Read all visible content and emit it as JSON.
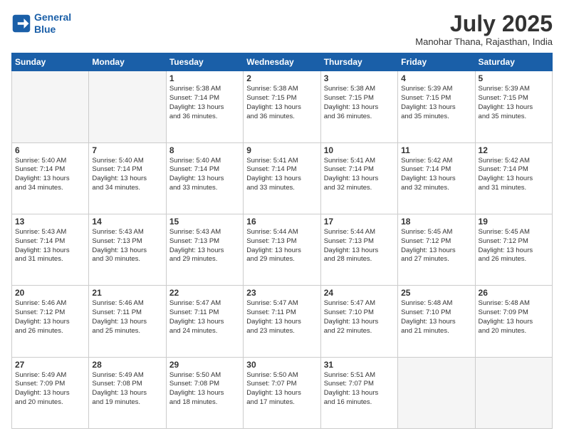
{
  "logo": {
    "line1": "General",
    "line2": "Blue"
  },
  "title": "July 2025",
  "subtitle": "Manohar Thana, Rajasthan, India",
  "weekdays": [
    "Sunday",
    "Monday",
    "Tuesday",
    "Wednesday",
    "Thursday",
    "Friday",
    "Saturday"
  ],
  "days": [
    {
      "num": "",
      "info": ""
    },
    {
      "num": "",
      "info": ""
    },
    {
      "num": "1",
      "info": "Sunrise: 5:38 AM\nSunset: 7:14 PM\nDaylight: 13 hours\nand 36 minutes."
    },
    {
      "num": "2",
      "info": "Sunrise: 5:38 AM\nSunset: 7:15 PM\nDaylight: 13 hours\nand 36 minutes."
    },
    {
      "num": "3",
      "info": "Sunrise: 5:38 AM\nSunset: 7:15 PM\nDaylight: 13 hours\nand 36 minutes."
    },
    {
      "num": "4",
      "info": "Sunrise: 5:39 AM\nSunset: 7:15 PM\nDaylight: 13 hours\nand 35 minutes."
    },
    {
      "num": "5",
      "info": "Sunrise: 5:39 AM\nSunset: 7:15 PM\nDaylight: 13 hours\nand 35 minutes."
    },
    {
      "num": "6",
      "info": "Sunrise: 5:40 AM\nSunset: 7:14 PM\nDaylight: 13 hours\nand 34 minutes."
    },
    {
      "num": "7",
      "info": "Sunrise: 5:40 AM\nSunset: 7:14 PM\nDaylight: 13 hours\nand 34 minutes."
    },
    {
      "num": "8",
      "info": "Sunrise: 5:40 AM\nSunset: 7:14 PM\nDaylight: 13 hours\nand 33 minutes."
    },
    {
      "num": "9",
      "info": "Sunrise: 5:41 AM\nSunset: 7:14 PM\nDaylight: 13 hours\nand 33 minutes."
    },
    {
      "num": "10",
      "info": "Sunrise: 5:41 AM\nSunset: 7:14 PM\nDaylight: 13 hours\nand 32 minutes."
    },
    {
      "num": "11",
      "info": "Sunrise: 5:42 AM\nSunset: 7:14 PM\nDaylight: 13 hours\nand 32 minutes."
    },
    {
      "num": "12",
      "info": "Sunrise: 5:42 AM\nSunset: 7:14 PM\nDaylight: 13 hours\nand 31 minutes."
    },
    {
      "num": "13",
      "info": "Sunrise: 5:43 AM\nSunset: 7:14 PM\nDaylight: 13 hours\nand 31 minutes."
    },
    {
      "num": "14",
      "info": "Sunrise: 5:43 AM\nSunset: 7:13 PM\nDaylight: 13 hours\nand 30 minutes."
    },
    {
      "num": "15",
      "info": "Sunrise: 5:43 AM\nSunset: 7:13 PM\nDaylight: 13 hours\nand 29 minutes."
    },
    {
      "num": "16",
      "info": "Sunrise: 5:44 AM\nSunset: 7:13 PM\nDaylight: 13 hours\nand 29 minutes."
    },
    {
      "num": "17",
      "info": "Sunrise: 5:44 AM\nSunset: 7:13 PM\nDaylight: 13 hours\nand 28 minutes."
    },
    {
      "num": "18",
      "info": "Sunrise: 5:45 AM\nSunset: 7:12 PM\nDaylight: 13 hours\nand 27 minutes."
    },
    {
      "num": "19",
      "info": "Sunrise: 5:45 AM\nSunset: 7:12 PM\nDaylight: 13 hours\nand 26 minutes."
    },
    {
      "num": "20",
      "info": "Sunrise: 5:46 AM\nSunset: 7:12 PM\nDaylight: 13 hours\nand 26 minutes."
    },
    {
      "num": "21",
      "info": "Sunrise: 5:46 AM\nSunset: 7:11 PM\nDaylight: 13 hours\nand 25 minutes."
    },
    {
      "num": "22",
      "info": "Sunrise: 5:47 AM\nSunset: 7:11 PM\nDaylight: 13 hours\nand 24 minutes."
    },
    {
      "num": "23",
      "info": "Sunrise: 5:47 AM\nSunset: 7:11 PM\nDaylight: 13 hours\nand 23 minutes."
    },
    {
      "num": "24",
      "info": "Sunrise: 5:47 AM\nSunset: 7:10 PM\nDaylight: 13 hours\nand 22 minutes."
    },
    {
      "num": "25",
      "info": "Sunrise: 5:48 AM\nSunset: 7:10 PM\nDaylight: 13 hours\nand 21 minutes."
    },
    {
      "num": "26",
      "info": "Sunrise: 5:48 AM\nSunset: 7:09 PM\nDaylight: 13 hours\nand 20 minutes."
    },
    {
      "num": "27",
      "info": "Sunrise: 5:49 AM\nSunset: 7:09 PM\nDaylight: 13 hours\nand 20 minutes."
    },
    {
      "num": "28",
      "info": "Sunrise: 5:49 AM\nSunset: 7:08 PM\nDaylight: 13 hours\nand 19 minutes."
    },
    {
      "num": "29",
      "info": "Sunrise: 5:50 AM\nSunset: 7:08 PM\nDaylight: 13 hours\nand 18 minutes."
    },
    {
      "num": "30",
      "info": "Sunrise: 5:50 AM\nSunset: 7:07 PM\nDaylight: 13 hours\nand 17 minutes."
    },
    {
      "num": "31",
      "info": "Sunrise: 5:51 AM\nSunset: 7:07 PM\nDaylight: 13 hours\nand 16 minutes."
    },
    {
      "num": "",
      "info": ""
    },
    {
      "num": "",
      "info": ""
    },
    {
      "num": "",
      "info": ""
    }
  ]
}
